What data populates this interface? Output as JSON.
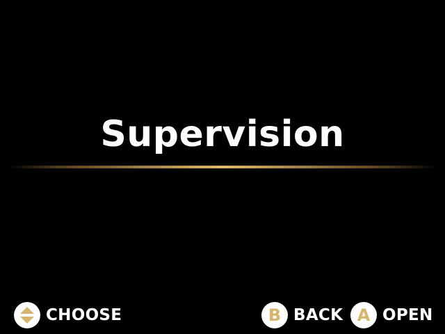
{
  "screen": {
    "title": "Supervision"
  },
  "controls": {
    "choose": {
      "icon": "dpad-up-down-icon",
      "label": "CHOOSE"
    },
    "back": {
      "button": "B",
      "icon": "b-button-icon",
      "label": "BACK"
    },
    "open": {
      "button": "A",
      "icon": "a-button-icon",
      "label": "OPEN"
    }
  },
  "colors": {
    "background": "#000000",
    "text": "#ffffff",
    "accent": "#d8b56d"
  }
}
